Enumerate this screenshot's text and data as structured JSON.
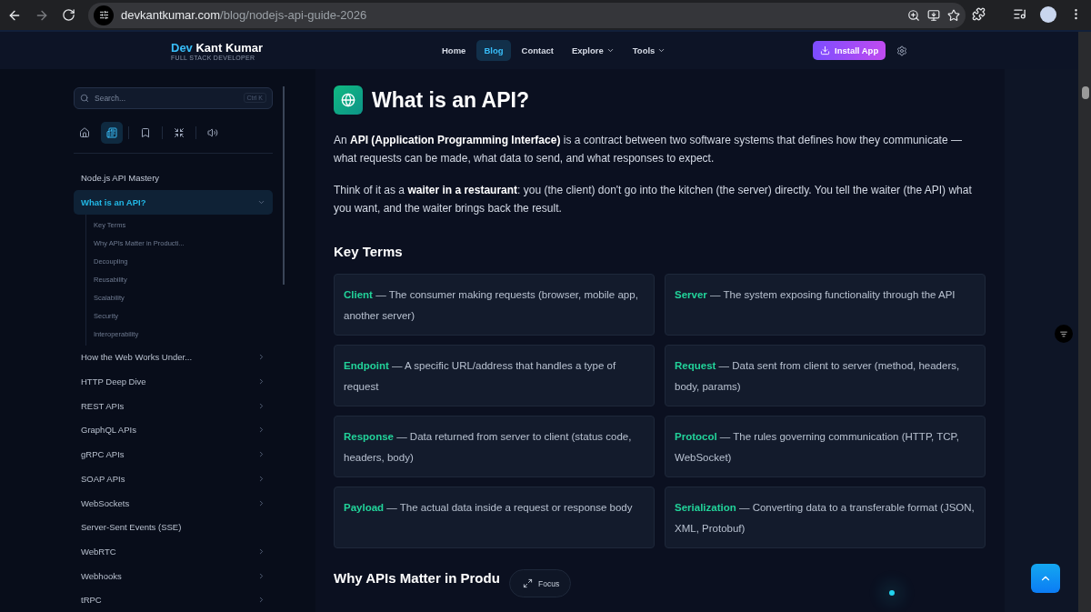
{
  "browser": {
    "url_domain": "devkantkumar.com",
    "url_path": "/blog/nodejs-api-guide-2026",
    "forward_disabled": true
  },
  "header": {
    "logo_first": "Dev",
    "logo_rest": "Kant Kumar",
    "tagline": "FULL STACK DEVELOPER",
    "nav": [
      {
        "label": "Home",
        "selected": false,
        "dropdown": false
      },
      {
        "label": "Blog",
        "selected": true,
        "dropdown": false
      },
      {
        "label": "Contact",
        "selected": false,
        "dropdown": false
      },
      {
        "label": "Explore",
        "selected": false,
        "dropdown": true
      },
      {
        "label": "Tools",
        "selected": false,
        "dropdown": true
      }
    ],
    "install_button": "Install App"
  },
  "sidebar": {
    "search": {
      "placeholder": "Search...",
      "shortcut": "Ctrl K"
    },
    "tools": [
      {
        "kind": "home",
        "selected": false
      },
      {
        "kind": "article",
        "selected": true
      },
      {
        "kind": "bookmark",
        "selected": false
      },
      {
        "kind": "focus",
        "selected": false
      },
      {
        "kind": "audio",
        "selected": false
      }
    ],
    "title": "Node.js API Mastery",
    "items": [
      {
        "label": "What is an API?",
        "selected": true,
        "expandable": true,
        "expanded": true,
        "children": [
          {
            "label": "Key Terms"
          },
          {
            "label": "Why APIs Matter in Producti..."
          },
          {
            "label": "Decoupling"
          },
          {
            "label": "Reusability"
          },
          {
            "label": "Scalability"
          },
          {
            "label": "Security"
          },
          {
            "label": "Interoperability"
          }
        ]
      },
      {
        "label": "How the Web Works Under...",
        "selected": false,
        "expandable": true,
        "expanded": false
      },
      {
        "label": "HTTP Deep Dive",
        "selected": false,
        "expandable": true,
        "expanded": false
      },
      {
        "label": "REST APIs",
        "selected": false,
        "expandable": true,
        "expanded": false
      },
      {
        "label": "GraphQL APIs",
        "selected": false,
        "expandable": true,
        "expanded": false
      },
      {
        "label": "gRPC APIs",
        "selected": false,
        "expandable": true,
        "expanded": false
      },
      {
        "label": "SOAP APIs",
        "selected": false,
        "expandable": true,
        "expanded": false
      },
      {
        "label": "WebSockets",
        "selected": false,
        "expandable": true,
        "expanded": false
      },
      {
        "label": "Server-Sent Events (SSE)",
        "selected": false,
        "expandable": false,
        "expanded": false
      },
      {
        "label": "WebRTC",
        "selected": false,
        "expandable": true,
        "expanded": false
      },
      {
        "label": "Webhooks",
        "selected": false,
        "expandable": true,
        "expanded": false
      },
      {
        "label": "tRPC",
        "selected": false,
        "expandable": true,
        "expanded": false
      }
    ]
  },
  "article": {
    "title": "What is an API?",
    "paragraphs": [
      "An **API (Application Programming Interface)** is a contract between two software systems that defines how they communicate — what requests can be made, what data to send, and what responses to expect.",
      "Think of it as a **waiter in a restaurant**: you (the client) don't go into the kitchen (the server) directly. You tell the waiter (the API) what you want, and the waiter brings back the result."
    ],
    "section_title": "Key Terms",
    "terms": [
      {
        "term": "Client",
        "description": " — The consumer making requests (browser, mobile app, another server)"
      },
      {
        "term": "Server",
        "description": " — The system exposing functionality through the API"
      },
      {
        "term": "Endpoint",
        "description": " — A specific URL/address that handles a type of request"
      },
      {
        "term": "Request",
        "description": " — Data sent from client to server (method, headers, body, params)"
      },
      {
        "term": "Response",
        "description": " — Data returned from server to client (status code, headers, body)"
      },
      {
        "term": "Protocol",
        "description": " — The rules governing communication (HTTP, TCP, WebSocket)"
      },
      {
        "term": "Payload",
        "description": " — The actual data inside a request or response body"
      },
      {
        "term": "Serialization",
        "description": " — Converting data to a transferable format (JSON, XML, Protobuf)"
      }
    ],
    "next_title": "Why APIs Matter in Produ"
  },
  "focus_button": "Focus"
}
